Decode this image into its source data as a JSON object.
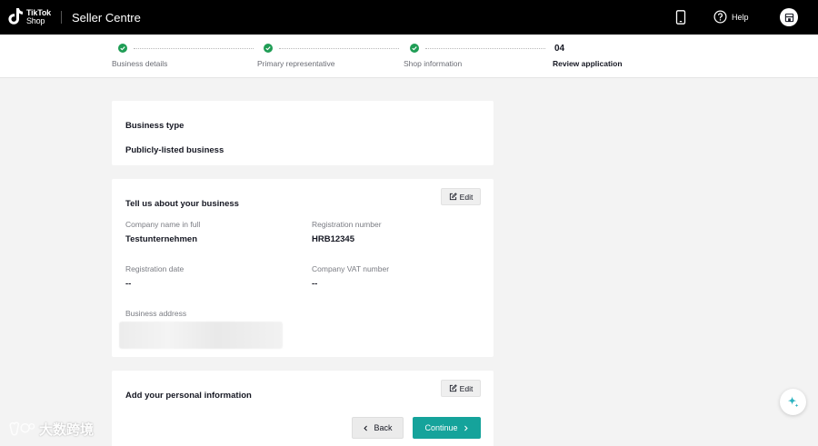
{
  "topbar": {
    "logo_line1": "TikTok",
    "logo_line2": "Shop",
    "title": "Seller Centre",
    "help_label": "Help",
    "icons": [
      "phone-icon",
      "help-icon",
      "shop-icon"
    ]
  },
  "stepper": {
    "steps": [
      {
        "label": "Business details",
        "status": "done"
      },
      {
        "label": "Primary representative",
        "status": "done"
      },
      {
        "label": "Shop information",
        "status": "done"
      },
      {
        "label": "Review application",
        "status": "current",
        "number": "04"
      }
    ]
  },
  "business_type": {
    "heading": "Business type",
    "value": "Publicly-listed business"
  },
  "business": {
    "heading": "Tell us about your business",
    "edit_label": "Edit",
    "company_name_label": "Company name in full",
    "company_name_value": "Testunternehmen",
    "registration_number_label": "Registration number",
    "registration_number_value": "HRB12345",
    "registration_date_label": "Registration date",
    "registration_date_value": "--",
    "vat_label": "Company VAT number",
    "vat_value": "--",
    "address_label": "Business address"
  },
  "personal": {
    "heading": "Add your personal information",
    "edit_label": "Edit"
  },
  "footer": {
    "back_label": "Back",
    "continue_label": "Continue"
  },
  "watermark": {
    "text": "大数跨境"
  },
  "colors": {
    "topbar": "#000000",
    "success": "#1f9d55",
    "primary": "#15a39b",
    "background": "#f3f3f3"
  }
}
